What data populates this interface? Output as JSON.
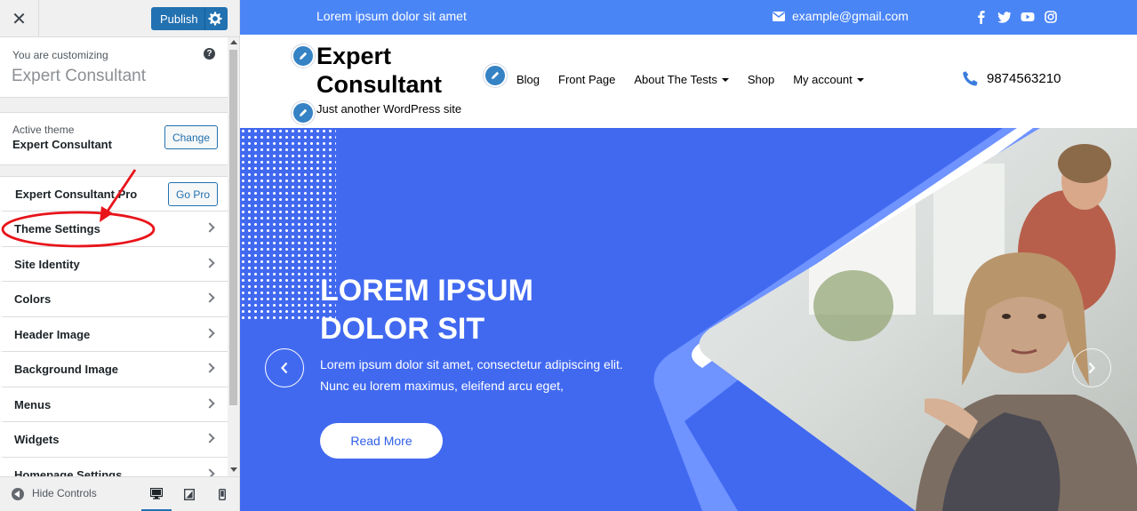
{
  "customizer": {
    "publish_label": "Publish",
    "customizing_small": "You are customizing",
    "customizing_site": "Expert Consultant",
    "help_symbol": "?",
    "active_theme_label": "Active theme",
    "active_theme_name": "Expert Consultant",
    "change_label": "Change",
    "pro_label": "Expert Consultant Pro",
    "go_pro_label": "Go Pro",
    "sections": [
      {
        "label": "Theme Settings"
      },
      {
        "label": "Site Identity"
      },
      {
        "label": "Colors"
      },
      {
        "label": "Header Image"
      },
      {
        "label": "Background Image"
      },
      {
        "label": "Menus"
      },
      {
        "label": "Widgets"
      },
      {
        "label": "Homepage Settings"
      }
    ],
    "hide_controls_label": "Hide Controls",
    "devices": [
      "desktop-icon",
      "tablet-icon",
      "mobile-icon"
    ]
  },
  "preview": {
    "topbar_text": "Lorem ipsum dolor sit amet",
    "email": "example@gmail.com",
    "social_icons": [
      "facebook-icon",
      "twitter-icon",
      "youtube-icon",
      "instagram-icon"
    ],
    "site_title": "Expert Consultant",
    "tagline": "Just another WordPress site",
    "nav": [
      {
        "label": "Blog",
        "dropdown": false
      },
      {
        "label": "Front Page",
        "dropdown": false
      },
      {
        "label": "About The Tests",
        "dropdown": true
      },
      {
        "label": "Shop",
        "dropdown": false
      },
      {
        "label": "My account",
        "dropdown": true
      }
    ],
    "phone": "9874563210",
    "hero": {
      "title": "LOREM IPSUM DOLOR SIT",
      "text": "Lorem ipsum dolor sit amet, consectetur adipiscing elit. Nunc eu lorem maximus, eleifend arcu eget,",
      "button": "Read More"
    }
  },
  "colors": {
    "wp_blue": "#2271b1",
    "topbar_blue": "#4a85f6",
    "hero_blue": "#4169f0",
    "annotation_red": "#e8141a"
  }
}
